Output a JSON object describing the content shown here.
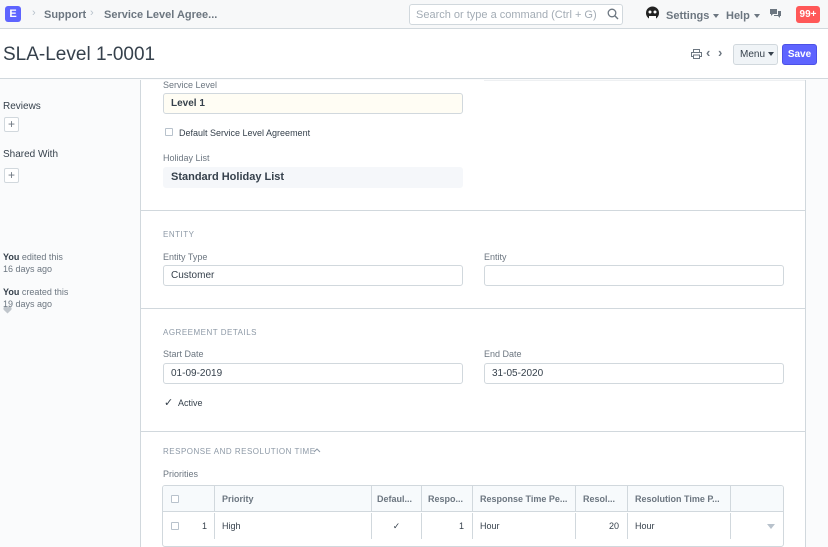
{
  "navbar": {
    "logo": "E",
    "breadcrumbs": [
      "Support",
      "Service Level Agree..."
    ],
    "search_placeholder": "Search or type a command (Ctrl + G)",
    "settings_label": "Settings",
    "help_label": "Help",
    "notification_count": "99+"
  },
  "page_head": {
    "title": "SLA-Level 1-0001",
    "menu_label": "Menu",
    "save_label": "Save"
  },
  "sidebar": {
    "reviews_label": "Reviews",
    "shared_with_label": "Shared With",
    "activity": [
      {
        "who": "You",
        "action": " edited this",
        "when": "16 days ago"
      },
      {
        "who": "You",
        "action": " created this",
        "when": "19 days ago"
      }
    ]
  },
  "form": {
    "service_level": {
      "label": "Service Level",
      "value": "Level 1"
    },
    "default_sla": {
      "label": "Default Service Level Agreement",
      "checked": false
    },
    "holiday_list": {
      "label": "Holiday List",
      "value": "Standard Holiday List"
    },
    "entity_section": {
      "heading": "ENTITY",
      "entity_type": {
        "label": "Entity Type",
        "value": "Customer"
      },
      "entity": {
        "label": "Entity",
        "value": ""
      }
    },
    "agreement_section": {
      "heading": "AGREEMENT DETAILS",
      "start_date": {
        "label": "Start Date",
        "value": "01-09-2019"
      },
      "end_date": {
        "label": "End Date",
        "value": "31-05-2020"
      },
      "active": {
        "label": "Active",
        "checked": true
      }
    },
    "response_section": {
      "heading": "RESPONSE AND RESOLUTION TIME",
      "priorities_label": "Priorities",
      "columns": [
        "Priority",
        "Defaul...",
        "Respo...",
        "Response Time Pe...",
        "Resol...",
        "Resolution Time P..."
      ],
      "rows": [
        {
          "idx": "1",
          "priority": "High",
          "default": "✓",
          "response": "1",
          "response_period": "Hour",
          "resolution": "20",
          "resolution_period": "Hour"
        }
      ]
    }
  }
}
